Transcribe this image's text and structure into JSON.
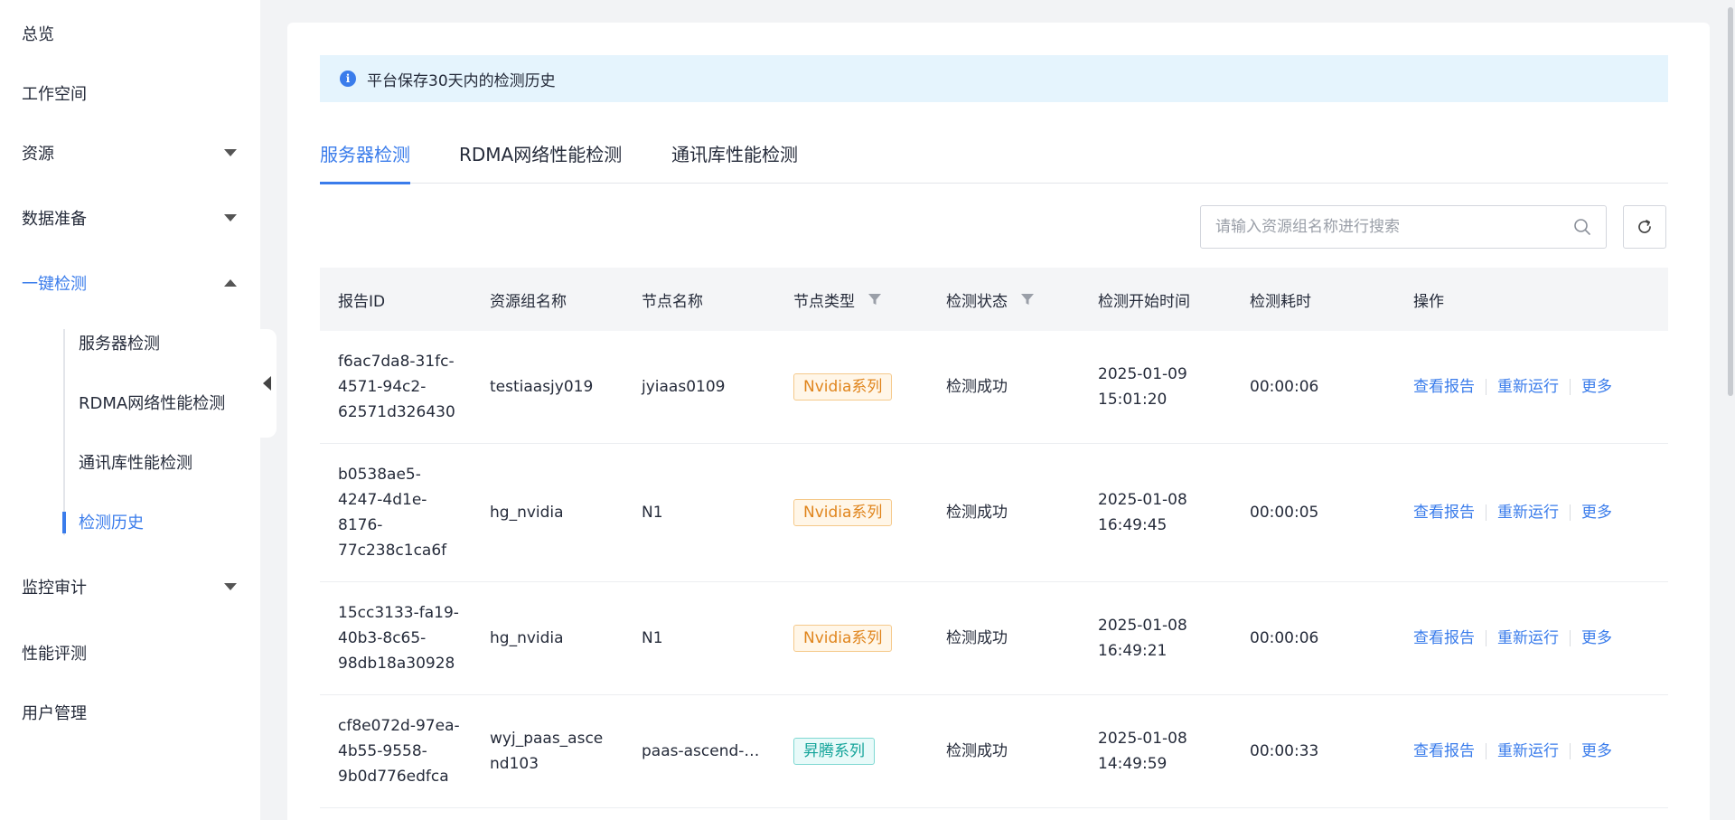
{
  "sidebar": {
    "items": [
      {
        "label": "总览"
      },
      {
        "label": "工作空间"
      },
      {
        "label": "资源"
      },
      {
        "label": "数据准备"
      },
      {
        "label": "一键检测"
      },
      {
        "label": "监控审计"
      },
      {
        "label": "性能评测"
      },
      {
        "label": "用户管理"
      }
    ],
    "sub_items": [
      {
        "label": "服务器检测"
      },
      {
        "label": "RDMA网络性能检测"
      },
      {
        "label": "通讯库性能检测"
      },
      {
        "label": "检测历史"
      }
    ]
  },
  "notice": {
    "text": "平台保存30天内的检测历史"
  },
  "tabs": [
    {
      "label": "服务器检测"
    },
    {
      "label": "RDMA网络性能检测"
    },
    {
      "label": "通讯库性能检测"
    }
  ],
  "search": {
    "placeholder": "请输入资源组名称进行搜索"
  },
  "table": {
    "columns": [
      "报告ID",
      "资源组名称",
      "节点名称",
      "节点类型",
      "检测状态",
      "检测开始时间",
      "检测耗时",
      "操作"
    ],
    "rows": [
      {
        "id_lines": [
          "f6ac7da8-31fc-",
          "4571-94c2-",
          "62571d326430"
        ],
        "group_lines": [
          "testiaasjy019"
        ],
        "node": "jyiaas0109",
        "type": "Nvidia系列",
        "status": "检测成功",
        "date": "2025-01-09",
        "time": "15:01:20",
        "duration": "00:00:06"
      },
      {
        "id_lines": [
          "b0538ae5-",
          "4247-4d1e-",
          "8176-",
          "77c238c1ca6f"
        ],
        "group_lines": [
          "hg_nvidia"
        ],
        "node": "N1",
        "type": "Nvidia系列",
        "status": "检测成功",
        "date": "2025-01-08",
        "time": "16:49:45",
        "duration": "00:00:05"
      },
      {
        "id_lines": [
          "15cc3133-fa19-",
          "40b3-8c65-",
          "98db18a30928"
        ],
        "group_lines": [
          "hg_nvidia"
        ],
        "node": "N1",
        "type": "Nvidia系列",
        "status": "检测成功",
        "date": "2025-01-08",
        "time": "16:49:21",
        "duration": "00:00:06"
      },
      {
        "id_lines": [
          "cf8e072d-97ea-",
          "4b55-9558-",
          "9b0d776edfca"
        ],
        "group_lines": [
          "wyj_paas_asce",
          "nd103"
        ],
        "node": "paas-ascend-…",
        "type": "昇腾系列",
        "status": "检测成功",
        "date": "2025-01-08",
        "time": "14:49:59",
        "duration": "00:00:33"
      }
    ],
    "actions": [
      "查看报告",
      "重新运行",
      "更多"
    ]
  },
  "colors": {
    "accent": "#3a7ceb",
    "nvidia_tag": "#e0851d",
    "ascend_tag": "#14a49a",
    "notice_bg": "#e5f4fd"
  },
  "icons": [
    "info-icon",
    "search-icon",
    "refresh-icon",
    "filter-icon",
    "chevron-down-icon",
    "chevron-up-icon",
    "collapse-left-icon"
  ]
}
